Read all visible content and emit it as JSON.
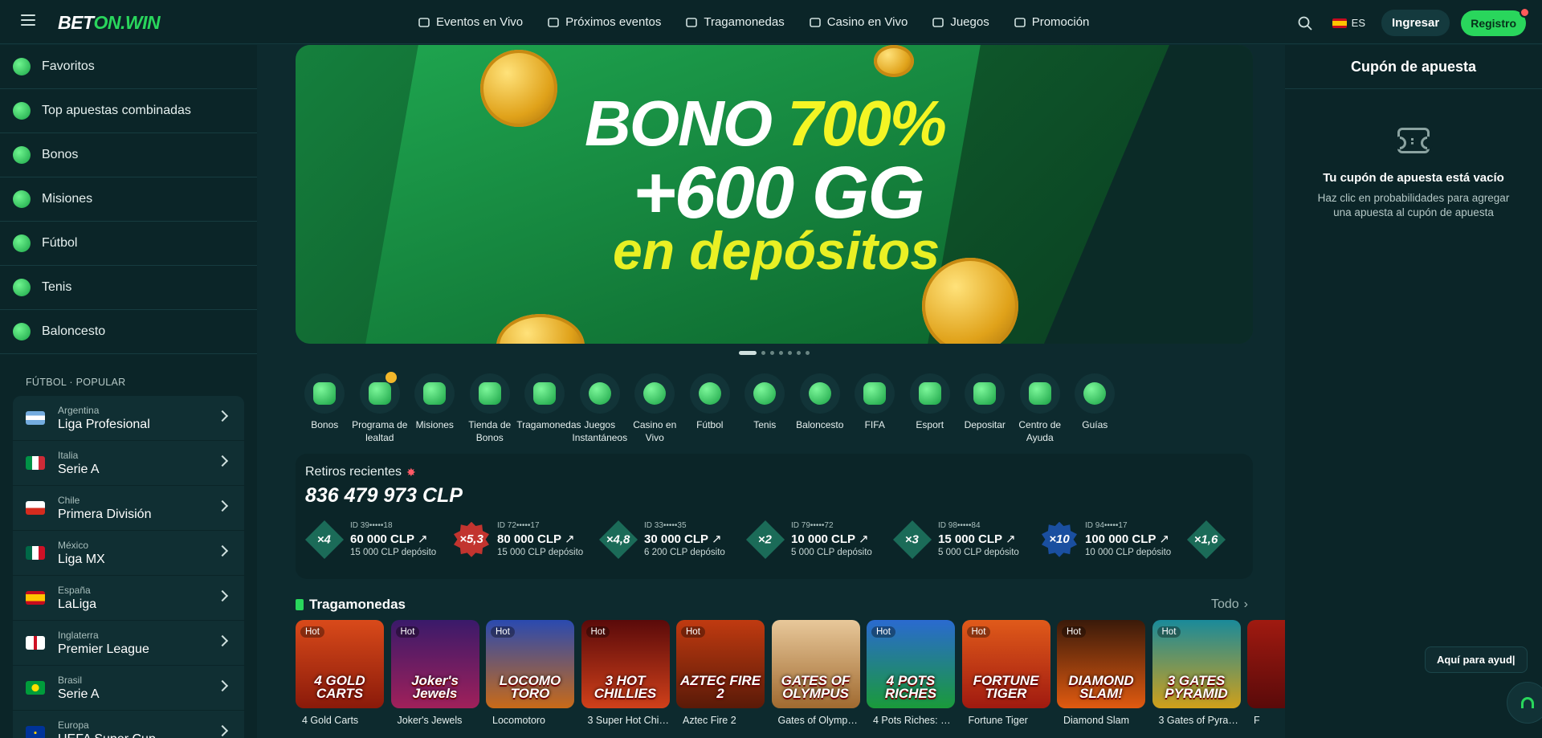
{
  "header": {
    "logo_a": "BET",
    "logo_b": "ON",
    "logo_c": ".WIN",
    "nav": [
      {
        "label": "Eventos en Vivo",
        "icon": "live-tv-icon"
      },
      {
        "label": "Próximos eventos",
        "icon": "calendar-icon"
      },
      {
        "label": "Tragamonedas",
        "icon": "slots-icon"
      },
      {
        "label": "Casino en Vivo",
        "icon": "chip-icon"
      },
      {
        "label": "Juegos",
        "icon": "rocket-icon"
      },
      {
        "label": "Promoción",
        "icon": "gift-icon"
      }
    ],
    "lang": "ES",
    "login": "Ingresar",
    "register": "Registro"
  },
  "sidebar": {
    "menu": [
      {
        "label": "Favoritos",
        "icon": "star-icon"
      },
      {
        "label": "Top apuestas combinadas",
        "icon": "ticket-icon"
      },
      {
        "label": "Bonos",
        "icon": "gift-icon"
      },
      {
        "label": "Misiones",
        "icon": "crown-icon"
      },
      {
        "label": "Fútbol",
        "icon": "football-icon"
      },
      {
        "label": "Tenis",
        "icon": "tennis-icon"
      },
      {
        "label": "Baloncesto",
        "icon": "basketball-icon"
      }
    ],
    "section_title": "FÚTBOL · POPULAR",
    "leagues": [
      {
        "country": "Argentina",
        "name": "Liga Profesional"
      },
      {
        "country": "Italia",
        "name": "Serie A"
      },
      {
        "country": "Chile",
        "name": "Primera División"
      },
      {
        "country": "México",
        "name": "Liga MX"
      },
      {
        "country": "España",
        "name": "LaLiga"
      },
      {
        "country": "Inglaterra",
        "name": "Premier League"
      },
      {
        "country": "Brasil",
        "name": "Serie A"
      },
      {
        "country": "Europa",
        "name": "UEFA Super Cup"
      }
    ]
  },
  "banner": {
    "line1_a": "BONO ",
    "line1_b": "700%",
    "line2": "+600 GG",
    "line3": "en depósitos",
    "slides": 7,
    "active_slide": 0
  },
  "categories": [
    {
      "label": "Bonos",
      "icon": "gift-icon"
    },
    {
      "label": "Programa de lealtad",
      "icon": "badge-icon"
    },
    {
      "label": "Misiones",
      "icon": "crown-icon"
    },
    {
      "label": "Tienda de Bonos",
      "icon": "cart-icon"
    },
    {
      "label": "Tragamonedas",
      "icon": "slots-icon"
    },
    {
      "label": "Juegos Instantáneos",
      "icon": "bomb-icon"
    },
    {
      "label": "Casino en Vivo",
      "icon": "chip-icon"
    },
    {
      "label": "Fútbol",
      "icon": "football-icon"
    },
    {
      "label": "Tenis",
      "icon": "tennis-icon"
    },
    {
      "label": "Baloncesto",
      "icon": "basketball-icon"
    },
    {
      "label": "FIFA",
      "icon": "fifa-icon"
    },
    {
      "label": "Esport",
      "icon": "gamepad-icon"
    },
    {
      "label": "Depositar",
      "icon": "wallet-icon"
    },
    {
      "label": "Centro de Ayuda",
      "icon": "chat-icon"
    },
    {
      "label": "Guías",
      "icon": "question-icon"
    }
  ],
  "withdrawals": {
    "title": "Retiros recientes",
    "total": "836 479 973 CLP",
    "items": [
      {
        "mult": "×4",
        "style": "dia",
        "id": "ID 39•••••18",
        "amount": "60 000 CLP",
        "deposit": "15 000 CLP depósito"
      },
      {
        "mult": "×5,3",
        "style": "red",
        "id": "ID 72•••••17",
        "amount": "80 000 CLP",
        "deposit": "15 000 CLP depósito"
      },
      {
        "mult": "×4,8",
        "style": "dia",
        "id": "ID 33•••••35",
        "amount": "30 000 CLP",
        "deposit": "6 200 CLP depósito"
      },
      {
        "mult": "×2",
        "style": "dia",
        "id": "ID 79•••••72",
        "amount": "10 000 CLP",
        "deposit": "5 000 CLP depósito"
      },
      {
        "mult": "×3",
        "style": "dia",
        "id": "ID 98•••••84",
        "amount": "15 000 CLP",
        "deposit": "5 000 CLP depósito"
      },
      {
        "mult": "×10",
        "style": "blue",
        "id": "ID 94•••••17",
        "amount": "100 000 CLP",
        "deposit": "10 000 CLP depósito"
      },
      {
        "mult": "×1,6",
        "style": "dia",
        "id": "",
        "amount": "",
        "deposit": ""
      }
    ]
  },
  "slots": {
    "title": "Tragamonedas",
    "all": "Todo",
    "games": [
      {
        "name": "4 Gold Carts",
        "art": "4 GOLD CARTS",
        "hot": "Hot",
        "bg": "linear-gradient(180deg,#d94a1a,#8a1a0a)"
      },
      {
        "name": "Joker's Jewels",
        "art": "Joker's Jewels",
        "hot": "Hot",
        "bg": "linear-gradient(180deg,#3a1a6a,#a0205a)"
      },
      {
        "name": "Locomotoro",
        "art": "LOCOMO TORO",
        "hot": "Hot",
        "bg": "linear-gradient(180deg,#2a4ab0,#c86a18)"
      },
      {
        "name": "3 Super Hot Chill...",
        "art": "3 HOT CHILLIES",
        "hot": "Hot",
        "bg": "linear-gradient(180deg,#5a0a0a,#d0401a)"
      },
      {
        "name": "Aztec Fire 2",
        "art": "AZTEC FIRE 2",
        "hot": "Hot",
        "bg": "linear-gradient(180deg,#c03a10,#5a1a08)"
      },
      {
        "name": "Gates of Olympu...",
        "art": "GATES OF OLYMPUS",
        "hot": "",
        "bg": "linear-gradient(180deg,#e8c89a,#a06a30)"
      },
      {
        "name": "4 Pots Riches: H...",
        "art": "4 POTS RICHES",
        "hot": "Hot",
        "bg": "linear-gradient(180deg,#2a6ad0,#1a9a3a)"
      },
      {
        "name": "Fortune Tiger",
        "art": "FORTUNE TIGER",
        "hot": "Hot",
        "bg": "linear-gradient(180deg,#e05a1a,#a01a10)"
      },
      {
        "name": "Diamond Slam",
        "art": "DIAMOND SLAM!",
        "hot": "Hot",
        "bg": "linear-gradient(180deg,#3a1a0a,#e05a10)"
      },
      {
        "name": "3 Gates of Pyram...",
        "art": "3 GATES PYRAMID",
        "hot": "Hot",
        "bg": "linear-gradient(180deg,#1a8a9a,#d0a01a)"
      },
      {
        "name": "F",
        "art": "",
        "hot": "",
        "bg": "linear-gradient(180deg,#a01a10,#5a0a0a)"
      }
    ]
  },
  "coupon": {
    "title": "Cupón de apuesta",
    "empty_title": "Tu cupón de apuesta está vacío",
    "empty_desc": "Haz clic en probabilidades para agregar una apuesta al cupón de apuesta"
  },
  "help": {
    "text": "Aquí para ayud|"
  },
  "colors": {
    "accent": "#29d65c",
    "bg": "#0d2a2e",
    "panel": "#0b2528"
  }
}
